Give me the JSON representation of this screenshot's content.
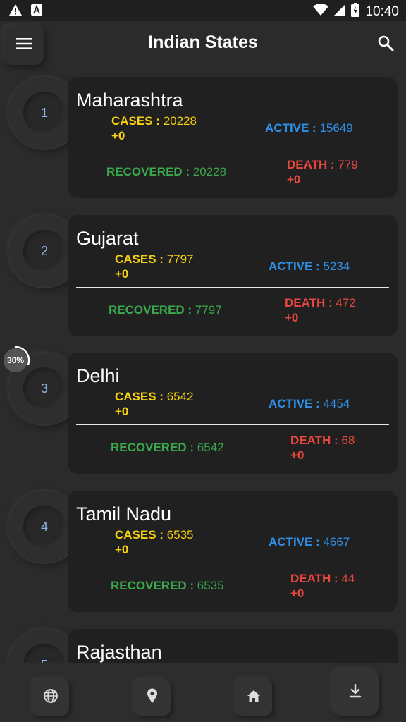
{
  "status": {
    "time": "10:40"
  },
  "header": {
    "title": "Indian States",
    "menu_icon": "menu-icon",
    "search_icon": "search-icon"
  },
  "labels": {
    "cases": "CASES : ",
    "active": "ACTIVE : ",
    "recovered": "RECOVERED : ",
    "death": "DEATH : "
  },
  "states": [
    {
      "rank": "1",
      "name": "Maharashtra",
      "cases": "20228",
      "cases_delta": "+0",
      "active": "15649",
      "recovered": "20228",
      "death": "779",
      "death_delta": "+0"
    },
    {
      "rank": "2",
      "name": "Gujarat",
      "cases": "7797",
      "cases_delta": "+0",
      "active": "5234",
      "recovered": "7797",
      "death": "472",
      "death_delta": "+0"
    },
    {
      "rank": "3",
      "name": "Delhi",
      "cases": "6542",
      "cases_delta": "+0",
      "active": "4454",
      "recovered": "6542",
      "death": "68",
      "death_delta": "+0"
    },
    {
      "rank": "4",
      "name": "Tamil Nadu",
      "cases": "6535",
      "cases_delta": "+0",
      "active": "4667",
      "recovered": "6535",
      "death": "44",
      "death_delta": "+0"
    },
    {
      "rank": "5",
      "name": "Rajasthan"
    }
  ],
  "progress": {
    "label": "30%",
    "value": 0.3
  },
  "bottom_nav": [
    "globe-icon",
    "location-pin-icon",
    "home-icon",
    "download-icon"
  ],
  "colors": {
    "cases": "#f5d10f",
    "active": "#2f8fe6",
    "recovered": "#3aa84d",
    "death": "#e8473f",
    "background": "#2b2b2b",
    "card": "#202020"
  }
}
